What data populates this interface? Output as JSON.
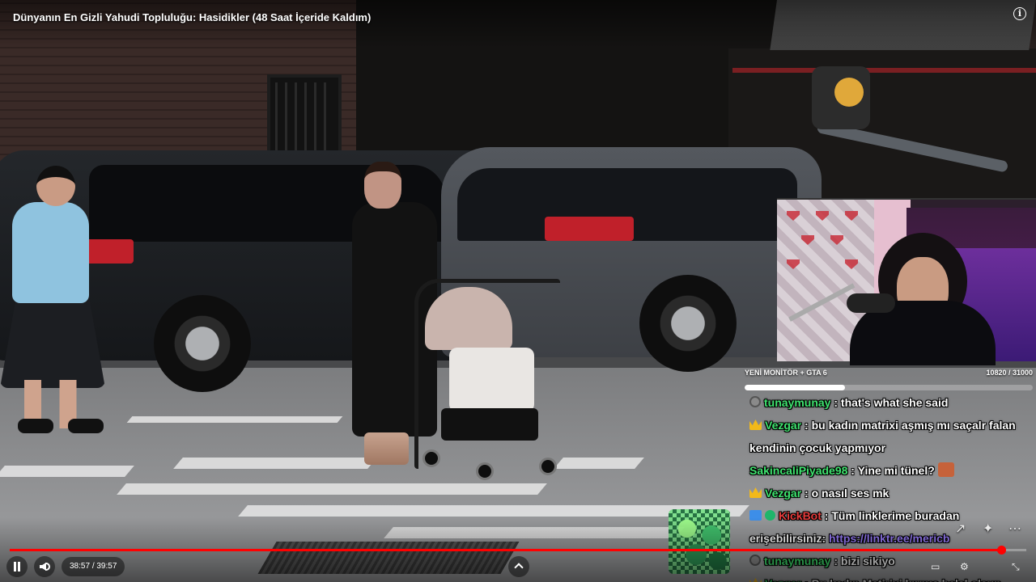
{
  "player": {
    "title": "Dünyanın En Gizli Yahudi Topluluğu: Hasidikler (48 Saat İçeride Kaldım)",
    "info_icon": "info-icon",
    "time_current": "38:57",
    "time_separator": "/",
    "time_total": "39:57",
    "progress_fraction": 0.975,
    "state": "playing",
    "accent_color": "#ff0000"
  },
  "goal": {
    "name": "YENİ MONİTÖR + GTA 6",
    "count": "10820 / 31000",
    "progress_fraction": 0.349
  },
  "chat": {
    "messages": [
      {
        "user": "tunaymunay",
        "text": "that's what she said",
        "user_color": "#3fe36f",
        "badge": "round"
      },
      {
        "user": "Vezgar",
        "text": "bu kadın matrixi aşmış mı saçalr falan kendinin çocuk yapmıyor",
        "user_color": "#3fe36f",
        "badge": "crown"
      },
      {
        "user": "SakincaliPiyade98",
        "text": "Yine mi tünel?",
        "user_color": "#3fe36f",
        "badge": "none",
        "emote": true
      },
      {
        "user": "Vezgar",
        "text": "o nasıl ses mk",
        "user_color": "#3fe36f",
        "badge": "crown"
      },
      {
        "user": "KickBot",
        "text": "Tüm linklerime buradan erişebilirsiniz:",
        "link": "https://linktr.ee/mericb",
        "user_color": "#e53b3b",
        "badge": "bot"
      },
      {
        "user": "tunaymunay",
        "text": "bizi sikiyo",
        "user_color": "#3fe36f",
        "badge": "round"
      },
      {
        "user": "Vezgar",
        "text": "Bu kadın Matirixi kırmış helal olsun",
        "user_color": "#3fe36f",
        "badge": "crown"
      }
    ]
  },
  "colors": {
    "chat_username": "#3fe36f",
    "bot_username": "#e53b3b",
    "link": "#9b7fff",
    "badge_crown": "#f2b91a"
  }
}
